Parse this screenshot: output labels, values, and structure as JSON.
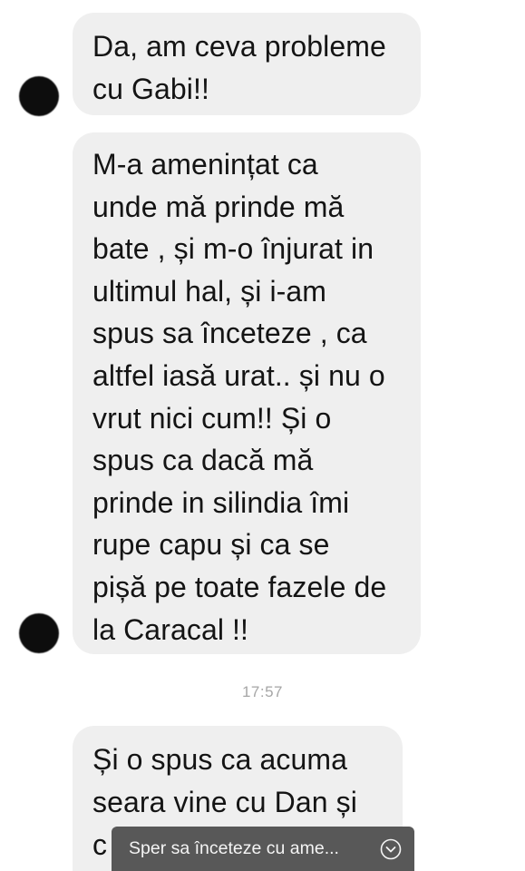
{
  "messages": [
    {
      "sender": "contact",
      "text": "Da, am ceva probleme\ncu Gabi!!"
    },
    {
      "sender": "contact",
      "text": "M-a amenințat ca\nunde mă prinde mă\nbate , și m-o înjurat in\nultimul hal, și i-am\nspus sa înceteze , ca\naltfel iasă urat.. și nu o\nvrut nici cum!! Și o\nspus ca dacă mă\nprinde in silindia îmi\nrupe capu și ca se\npișă pe toate fazele de\nla Caracal !!"
    },
    {
      "sender": "contact",
      "text": "Și o spus ca acuma\nseara vine cu Dan și\nc"
    }
  ],
  "timestamp": "17:57",
  "preview_bar": {
    "text": "Sper sa înceteze cu ame...",
    "icon": "chevron-down-circle-icon"
  },
  "colors": {
    "bubble": "#efefef",
    "timestamp": "#a6a6a6",
    "preview_bar": "#585858",
    "avatar": "#0d0d0d"
  }
}
